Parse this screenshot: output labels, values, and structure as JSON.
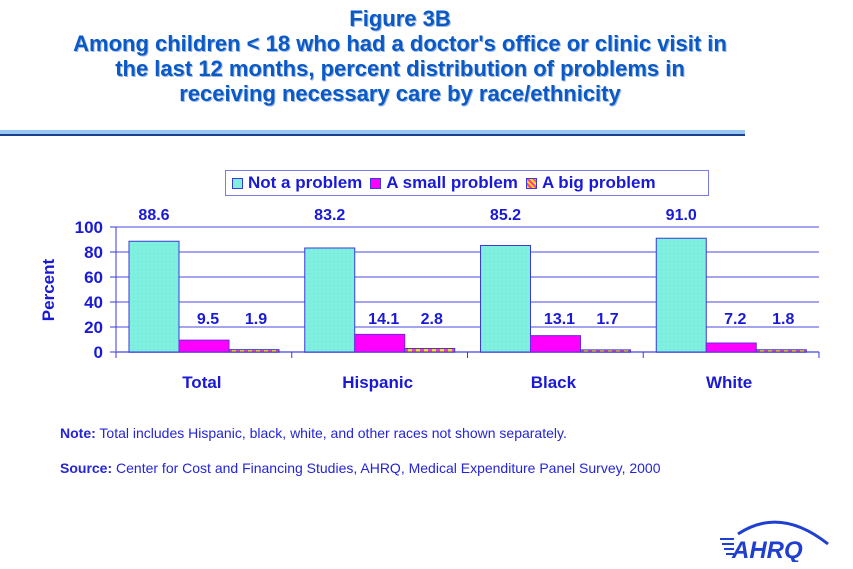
{
  "header": {
    "figure_label": "Figure 3B",
    "title_lines": [
      "Among children < 18 who had a doctor's office or clinic visit in",
      "the last 12 months, percent distribution of problems in",
      "receiving necessary care by race/ethnicity"
    ]
  },
  "chart_data": {
    "type": "bar",
    "title": "Among children < 18 who had a doctor's office or clinic visit in the last 12 months, percent distribution of problems in receiving necessary care by race/ethnicity",
    "categories": [
      "Total",
      "Hispanic",
      "Black",
      "White"
    ],
    "series": [
      {
        "name": "Not a problem",
        "values": [
          88.6,
          83.2,
          85.2,
          91.0
        ],
        "color": "#7ff0e0"
      },
      {
        "name": "A small problem",
        "values": [
          9.5,
          14.1,
          13.1,
          7.2
        ],
        "color": "#ff00ff"
      },
      {
        "name": "A big problem",
        "values": [
          1.9,
          2.8,
          1.7,
          1.8
        ],
        "color": "#ffe000"
      }
    ],
    "data_labels": [
      [
        "88.6",
        "9.5",
        "1.9"
      ],
      [
        "83.2",
        "14.1",
        "2.8"
      ],
      [
        "85.2",
        "13.1",
        "1.7"
      ],
      [
        "91.0",
        "7.2",
        "1.8"
      ]
    ],
    "xlabel": "",
    "ylabel": "Percent",
    "ylim": [
      0,
      100
    ],
    "yticks": [
      "0",
      "20",
      "40",
      "60",
      "80",
      "100"
    ],
    "grid": true,
    "legend_position": "top"
  },
  "colors": {
    "text": "#1a1ad6",
    "title": "#0b59c4",
    "axis": "#3a3ad6"
  },
  "footer": {
    "note_label": "Note:",
    "note_text": " Total includes Hispanic, black, white, and other races not shown separately.",
    "source_label": "Source:",
    "source_text": " Center for Cost and Financing Studies, AHRQ, Medical Expenditure Panel Survey, 2000",
    "logo_text": "AHRQ"
  }
}
